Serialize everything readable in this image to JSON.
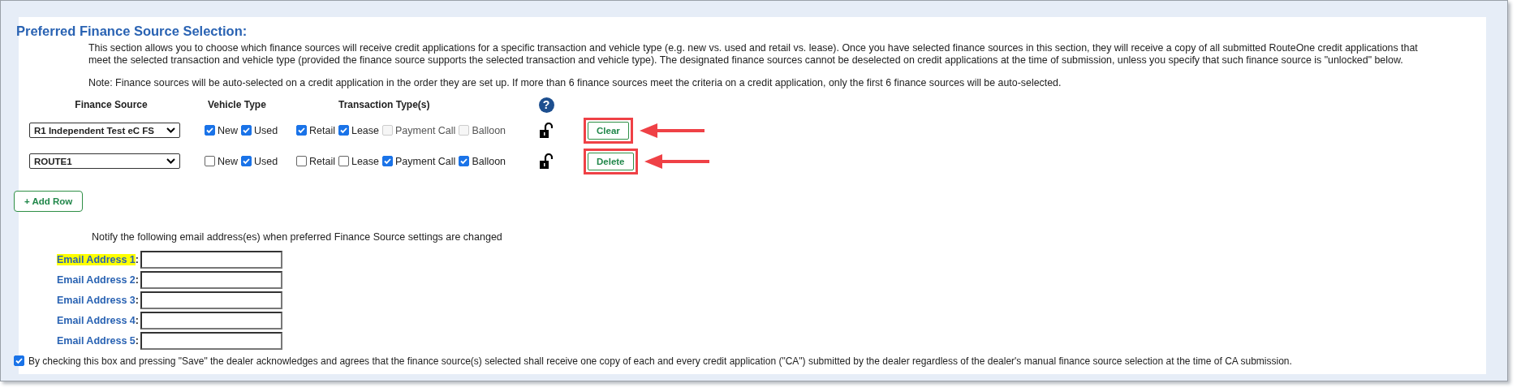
{
  "section": {
    "title": "Preferred Finance Source Selection:",
    "description": "This section allows you to choose which finance sources will receive credit applications for a specific transaction and vehicle type (e.g. new vs. used and retail vs. lease). Once you have selected finance sources in this section, they will receive a copy of all submitted RouteOne credit applications that meet the selected transaction and vehicle type (provided the finance source supports the selected transaction and vehicle type). The designated finance sources cannot be deselected on credit applications at the time of submission, unless you specify that such finance source is \"unlocked\" below.",
    "note": "Note: Finance sources will be auto-selected on a credit application in the order they are set up. If more than 6 finance sources meet the criteria on a credit application, only the first 6 finance sources will be auto-selected."
  },
  "table": {
    "columns": [
      "Finance Source",
      "Vehicle Type",
      "Transaction Type(s)"
    ],
    "help_icon": "?",
    "rows": [
      {
        "finance_source": "R1 Independent Test eC FS",
        "locked": false,
        "action": "Clear",
        "annotated": true,
        "options": [
          {
            "label": "New",
            "checked": true,
            "disabled": false
          },
          {
            "label": "Used",
            "checked": true,
            "disabled": false
          },
          {
            "label": "Retail",
            "checked": true,
            "disabled": false
          },
          {
            "label": "Lease",
            "checked": true,
            "disabled": false
          },
          {
            "label": "Payment Call",
            "checked": false,
            "disabled": true
          },
          {
            "label": "Balloon",
            "checked": false,
            "disabled": true
          }
        ]
      },
      {
        "finance_source": "ROUTE1",
        "locked": false,
        "action": "Delete",
        "annotated": true,
        "options": [
          {
            "label": "New",
            "checked": false,
            "disabled": false
          },
          {
            "label": "Used",
            "checked": true,
            "disabled": false
          },
          {
            "label": "Retail",
            "checked": false,
            "disabled": false
          },
          {
            "label": "Lease",
            "checked": false,
            "disabled": false
          },
          {
            "label": "Payment Call",
            "checked": true,
            "disabled": false
          },
          {
            "label": "Balloon",
            "checked": true,
            "disabled": false
          }
        ]
      }
    ]
  },
  "add_row_button": "+ Add Row",
  "email": {
    "intro": "Notify the following email address(es) when preferred Finance Source settings are changed",
    "fields": [
      {
        "label": "Email Address 1",
        "colon": ":",
        "highlighted": true
      },
      {
        "label": "Email Address 2",
        "colon": ":",
        "highlighted": false
      },
      {
        "label": "Email Address 3",
        "colon": ":",
        "highlighted": false
      },
      {
        "label": "Email Address 4",
        "colon": ":",
        "highlighted": false
      },
      {
        "label": "Email Address 5",
        "colon": ":",
        "highlighted": false
      }
    ]
  },
  "acknowledgement": {
    "checked": true,
    "text": "By checking this box and pressing \"Save\" the dealer acknowledges and agrees that the finance source(s) selected shall receive one copy of each and every credit application (\"CA\") submitted by the dealer regardless of the dealer's manual finance source selection at the time of CA submission."
  }
}
